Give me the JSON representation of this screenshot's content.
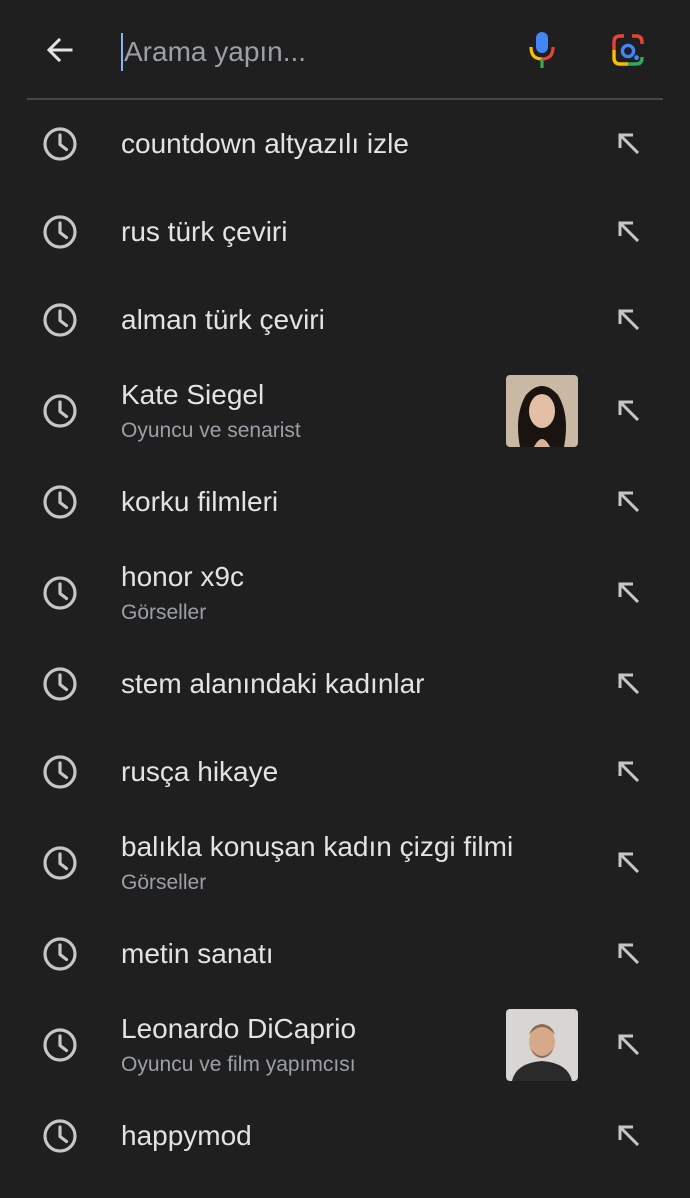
{
  "search": {
    "placeholder": "Arama yapın..."
  },
  "icons": {
    "back": "arrow-left-icon",
    "mic": "microphone-icon",
    "lens": "google-lens-icon",
    "history": "clock-icon",
    "fill": "arrow-up-left-icon"
  },
  "colors": {
    "background": "#1f1f1f",
    "text": "#e3e3e3",
    "secondary_text": "#9aa0a6",
    "icon": "#c4c7c5",
    "divider": "#474747",
    "google_blue": "#4285f4",
    "google_red": "#ea4335",
    "google_yellow": "#fbbc04",
    "google_green": "#34a853"
  },
  "suggestions": [
    {
      "title": "countdown altyazılı izle",
      "subtitle": ""
    },
    {
      "title": "rus türk çeviri",
      "subtitle": ""
    },
    {
      "title": "alman türk çeviri",
      "subtitle": ""
    },
    {
      "title": "Kate Siegel",
      "subtitle": "Oyuncu ve senarist",
      "thumbnail": "portrait-woman-dark-hair"
    },
    {
      "title": "korku filmleri",
      "subtitle": ""
    },
    {
      "title": "honor x9c",
      "subtitle": "Görseller"
    },
    {
      "title": "stem alanındaki kadınlar",
      "subtitle": ""
    },
    {
      "title": "rusça hikaye",
      "subtitle": ""
    },
    {
      "title": "balıkla konuşan kadın çizgi filmi",
      "subtitle": "Görseller"
    },
    {
      "title": "metin sanatı",
      "subtitle": ""
    },
    {
      "title": "Leonardo DiCaprio",
      "subtitle": "Oyuncu ve film yapımcısı",
      "thumbnail": "portrait-man-beard"
    },
    {
      "title": "happymod",
      "subtitle": ""
    }
  ]
}
